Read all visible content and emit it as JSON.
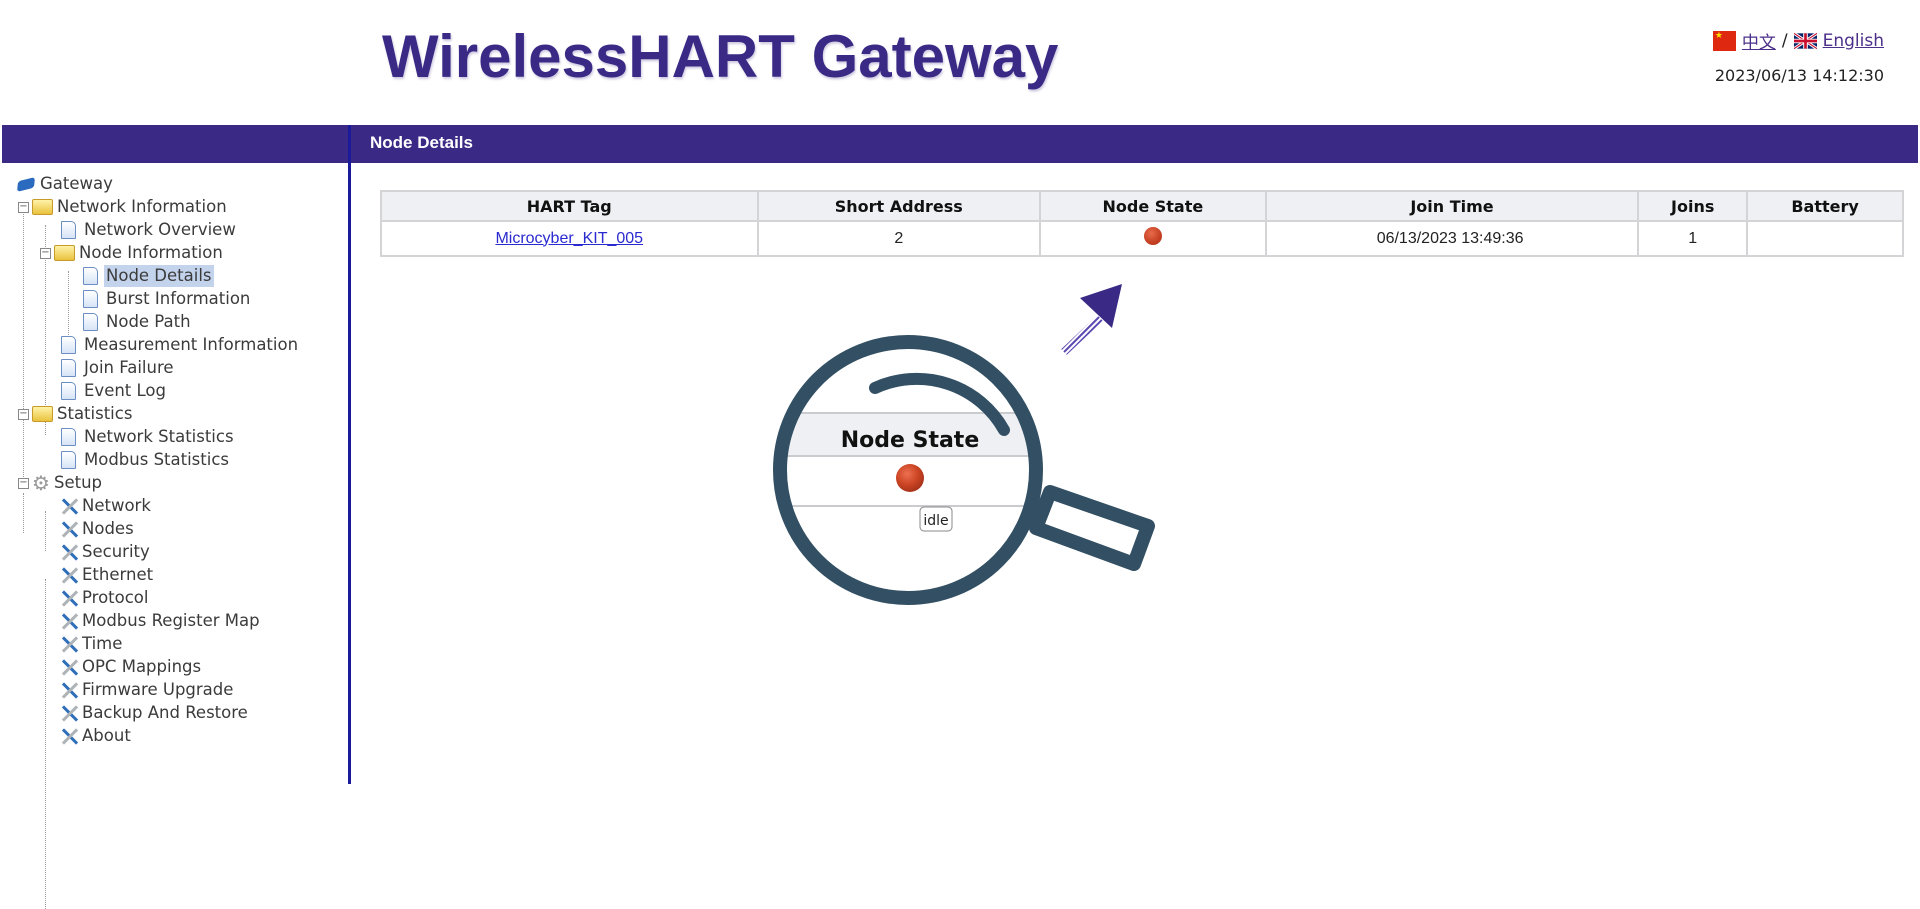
{
  "header": {
    "title": "WirelessHART Gateway",
    "lang_chinese": "中文",
    "lang_separator": "/",
    "lang_english": "English",
    "datetime": "2023/06/13 14:12:30"
  },
  "page_title": "Node Details",
  "sidebar": {
    "root": "Gateway",
    "items": [
      {
        "label": "Network Information",
        "type": "folder"
      },
      {
        "label": "Network Overview",
        "type": "page"
      },
      {
        "label": "Node Information",
        "type": "folder"
      },
      {
        "label": "Node Details",
        "type": "page",
        "selected": true
      },
      {
        "label": "Burst Information",
        "type": "page"
      },
      {
        "label": "Node Path",
        "type": "page"
      },
      {
        "label": "Measurement Information",
        "type": "page"
      },
      {
        "label": "Join Failure",
        "type": "page"
      },
      {
        "label": "Event Log",
        "type": "page"
      },
      {
        "label": "Statistics",
        "type": "folder"
      },
      {
        "label": "Network Statistics",
        "type": "page"
      },
      {
        "label": "Modbus Statistics",
        "type": "page"
      },
      {
        "label": "Setup",
        "type": "gear"
      },
      {
        "label": "Network",
        "type": "tool"
      },
      {
        "label": "Nodes",
        "type": "tool"
      },
      {
        "label": "Security",
        "type": "tool"
      },
      {
        "label": "Ethernet",
        "type": "tool"
      },
      {
        "label": "Protocol",
        "type": "tool"
      },
      {
        "label": "Modbus Register Map",
        "type": "tool"
      },
      {
        "label": "Time",
        "type": "tool"
      },
      {
        "label": "OPC Mappings",
        "type": "tool"
      },
      {
        "label": "Firmware Upgrade",
        "type": "tool"
      },
      {
        "label": "Backup And Restore",
        "type": "tool"
      },
      {
        "label": "About",
        "type": "tool"
      }
    ]
  },
  "table": {
    "columns": [
      "HART Tag",
      "Short Address",
      "Node State",
      "Join Time",
      "Joins",
      "Battery"
    ],
    "rows": [
      {
        "hart_tag": "Microcyber_KIT_005",
        "short_address": "2",
        "node_state": "idle",
        "node_state_color": "#c9432a",
        "join_time": "06/13/2023 13:49:36",
        "joins": "1",
        "battery": ""
      }
    ]
  },
  "callout": {
    "header": "Node State",
    "tooltip": "idle"
  },
  "colors": {
    "brand": "#3a2a85",
    "divider": "#1a1a9a",
    "magnifier": "#324f63"
  }
}
